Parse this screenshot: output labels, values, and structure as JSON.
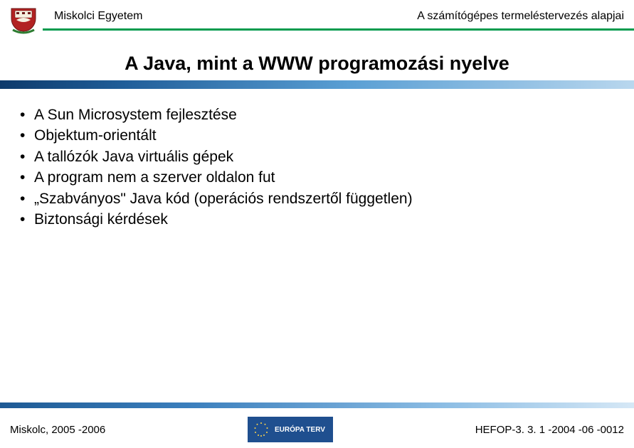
{
  "header": {
    "university": "Miskolci Egyetem",
    "course": "A számítógépes termeléstervezés alapjai"
  },
  "title": "A Java, mint a WWW programozási nyelve",
  "bullets": [
    "A Sun Microsystem fejlesztése",
    "Objektum-orientált",
    "A tallózók Java virtuális gépek",
    "A program nem a szerver oldalon fut",
    "„Szabványos\" Java kód (operációs rendszertől független)",
    "Biztonsági kérdések"
  ],
  "footer": {
    "left": "Miskolc, 2005 -2006",
    "eu_label": "EURÓPA TERV",
    "right": "HEFOP-3. 3. 1 -2004 -06 -0012"
  }
}
